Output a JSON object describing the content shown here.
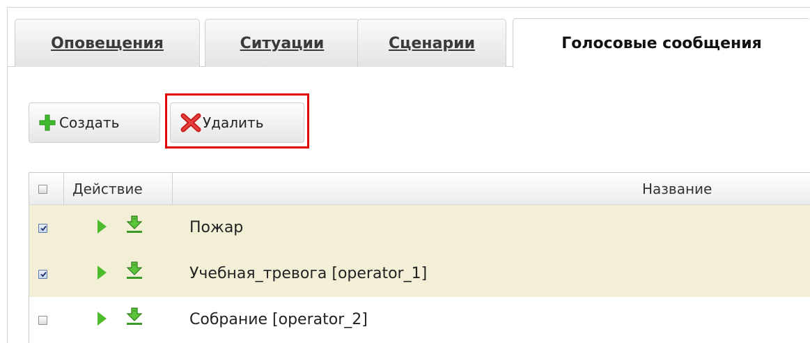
{
  "tabs": [
    {
      "label": "Оповещения"
    },
    {
      "label": "Ситуации"
    },
    {
      "label": "Сценарии"
    },
    {
      "label": "Голосовые сообщения"
    }
  ],
  "toolbar": {
    "create_label": "Создать",
    "delete_label": "Удалить"
  },
  "grid": {
    "columns": {
      "action": "Действие",
      "name": "Название"
    },
    "rows": [
      {
        "checked": true,
        "name": "Пожар"
      },
      {
        "checked": true,
        "name": "Учебная_тревога [operator_1]"
      },
      {
        "checked": false,
        "name": "Собрание [operator_2]"
      }
    ]
  },
  "colors": {
    "selected_row": "#f3efd6",
    "highlight": "#e00000",
    "play_icon": "#4cbc2c",
    "create_icon": "#3dbb2c",
    "delete_icon": "#d62222"
  },
  "icons": [
    "plus-icon",
    "cross-icon",
    "play-icon",
    "download-icon",
    "checkbox"
  ]
}
